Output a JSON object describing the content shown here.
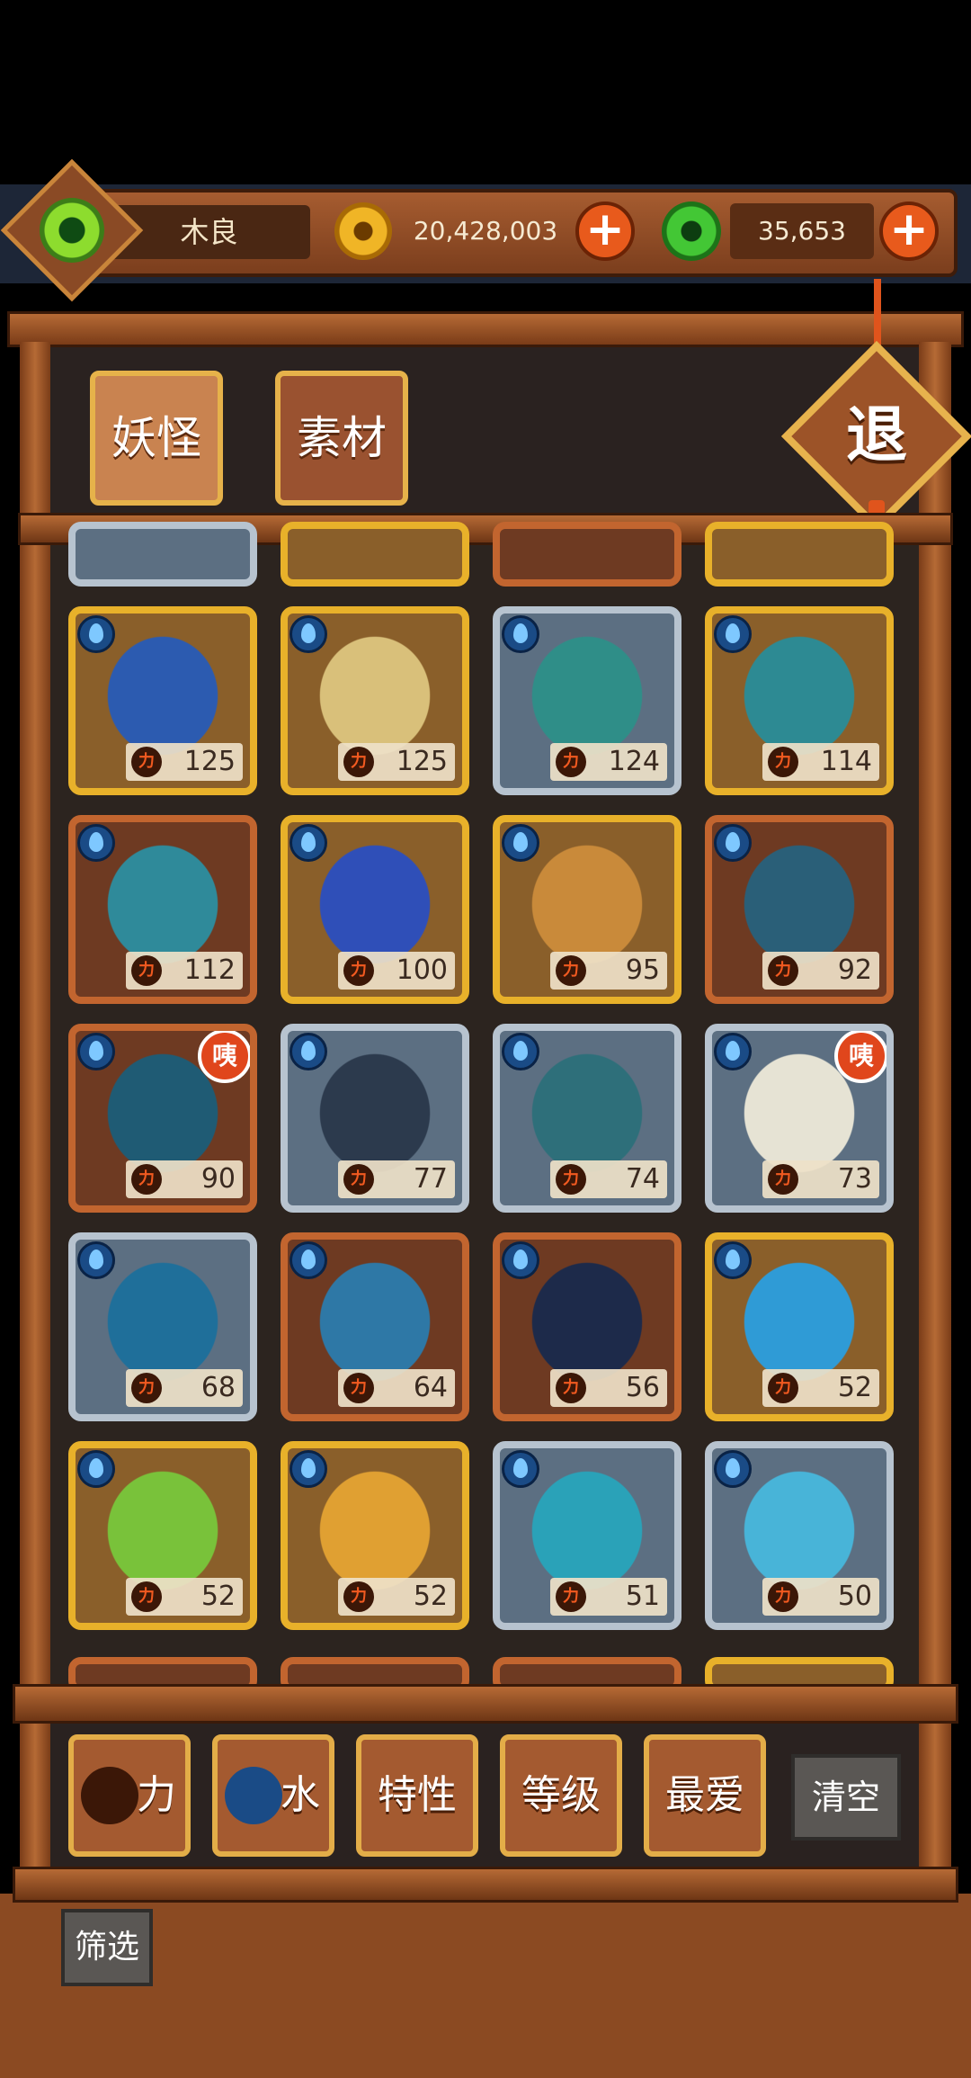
{
  "header": {
    "player_name": "木良",
    "gold_amount": "20,428,003",
    "jade_amount": "35,653",
    "add_symbol": "+"
  },
  "tabs": [
    {
      "label": "妖怪",
      "selected": true
    },
    {
      "label": "素材",
      "selected": false
    }
  ],
  "exit_label": "退",
  "power_glyph": "力",
  "element_icon": "water-drop-icon",
  "badge_label": "咦",
  "heroes": [
    {
      "rarity": "gold",
      "power": "125",
      "badge": false,
      "color": "#2c5bb0"
    },
    {
      "rarity": "gold",
      "power": "125",
      "badge": false,
      "color": "#d9c07a"
    },
    {
      "rarity": "silver",
      "power": "124",
      "badge": false,
      "color": "#2f8e88"
    },
    {
      "rarity": "gold",
      "power": "114",
      "badge": false,
      "color": "#2d8a93"
    },
    {
      "rarity": "copper",
      "power": "112",
      "badge": false,
      "color": "#2f8a9a"
    },
    {
      "rarity": "gold",
      "power": "100",
      "badge": false,
      "color": "#2f4fb8"
    },
    {
      "rarity": "gold",
      "power": "95",
      "badge": false,
      "color": "#c98a3a"
    },
    {
      "rarity": "copper",
      "power": "92",
      "badge": false,
      "color": "#2a5f78"
    },
    {
      "rarity": "copper",
      "power": "90",
      "badge": true,
      "color": "#1f5b74"
    },
    {
      "rarity": "silver",
      "power": "77",
      "badge": false,
      "color": "#2c3a4d"
    },
    {
      "rarity": "silver",
      "power": "74",
      "badge": false,
      "color": "#2e6f7a"
    },
    {
      "rarity": "silver",
      "power": "73",
      "badge": true,
      "color": "#e6e3d4"
    },
    {
      "rarity": "silver",
      "power": "68",
      "badge": false,
      "color": "#1f6f9a"
    },
    {
      "rarity": "copper",
      "power": "64",
      "badge": false,
      "color": "#2e78a6"
    },
    {
      "rarity": "copper",
      "power": "56",
      "badge": false,
      "color": "#1d2a4a"
    },
    {
      "rarity": "gold",
      "power": "52",
      "badge": false,
      "color": "#2f9bd6"
    },
    {
      "rarity": "gold",
      "power": "52",
      "badge": false,
      "color": "#79c23a"
    },
    {
      "rarity": "gold",
      "power": "52",
      "badge": false,
      "color": "#e0a032"
    },
    {
      "rarity": "silver",
      "power": "51",
      "badge": false,
      "color": "#2aa2b8"
    },
    {
      "rarity": "silver",
      "power": "50",
      "badge": false,
      "color": "#48b4d8"
    }
  ],
  "filters": [
    {
      "label": "力",
      "icon": "power-icon"
    },
    {
      "label": "水",
      "icon": "water-drop-icon"
    },
    {
      "label": "特性"
    },
    {
      "label": "等级"
    },
    {
      "label": "最爱"
    }
  ],
  "clear_label": "清空",
  "filter_label": "筛选"
}
